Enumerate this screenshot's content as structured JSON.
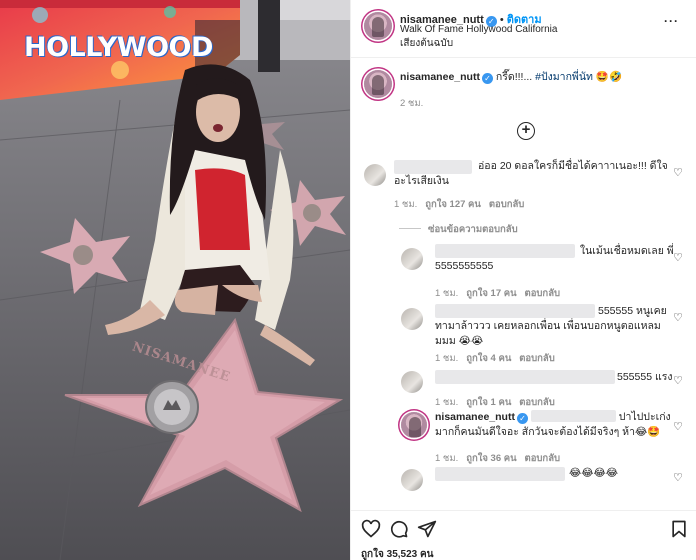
{
  "photo": {
    "bus_sign": "HOLLYWOOD",
    "star_name": "NISAMANEE"
  },
  "header": {
    "username": "nisamanee_nutt",
    "follow_label": "ติดตาม",
    "location": "Walk Of Fame Hollywood California",
    "audio": "เสียงต้นฉบับ",
    "more_label": "···"
  },
  "caption": {
    "username": "nisamanee_nutt",
    "text": "กรี๊ด!!!... ",
    "hashtag": "#ปังมากพี่นัท",
    "emoji": "🤩🤣",
    "time": "2 ชม."
  },
  "load_more_label": "+",
  "comments": [
    {
      "text": "อ่ออ 20 ดอลใครก็มีชื่อได้คาาาเนอะ!!! ดีใจอะไรเสียเงิน",
      "time": "1 ชม.",
      "likes": "ถูกใจ 127 คน",
      "reply": "ตอบกลับ",
      "hide_replies": "ซ่อนข้อความตอบกลับ"
    },
    {
      "text": "ในเม้นเชื่อหมดเลย พี่ 5555555555",
      "time": "1 ชม.",
      "likes": "ถูกใจ 17 คน",
      "reply": "ตอบกลับ"
    },
    {
      "text": "555555 หนูเคยทามาล้าววว เคยหลอกเพื่อน เพื่อนบอกหนูตอแหลมมมม 😭😭",
      "time": "1 ชม.",
      "likes": "ถูกใจ 4 คน",
      "reply": "ตอบกลับ"
    },
    {
      "text": "555555 แรง",
      "time": "1 ชม.",
      "likes": "ถูกใจ 1 คน",
      "reply": "ตอบกลับ"
    },
    {
      "username": "nisamanee_nutt",
      "text": "ปาไปปะเก่งมากก็คนมันดีใจอะ สักวันจะต้องได้มีจริงๆ ห้า😂🤩",
      "time": "1 ชม.",
      "likes": "ถูกใจ 36 คน",
      "reply": "ตอบกลับ"
    },
    {
      "text": "😂😂😂😂",
      "time": "",
      "likes": "",
      "reply": ""
    }
  ],
  "footer": {
    "likes": "ถูกใจ 35,523 คน"
  },
  "colors": {
    "accent": "#0095f6",
    "verified": "#3897f0",
    "text": "#262626",
    "muted": "#8e8e8e"
  }
}
